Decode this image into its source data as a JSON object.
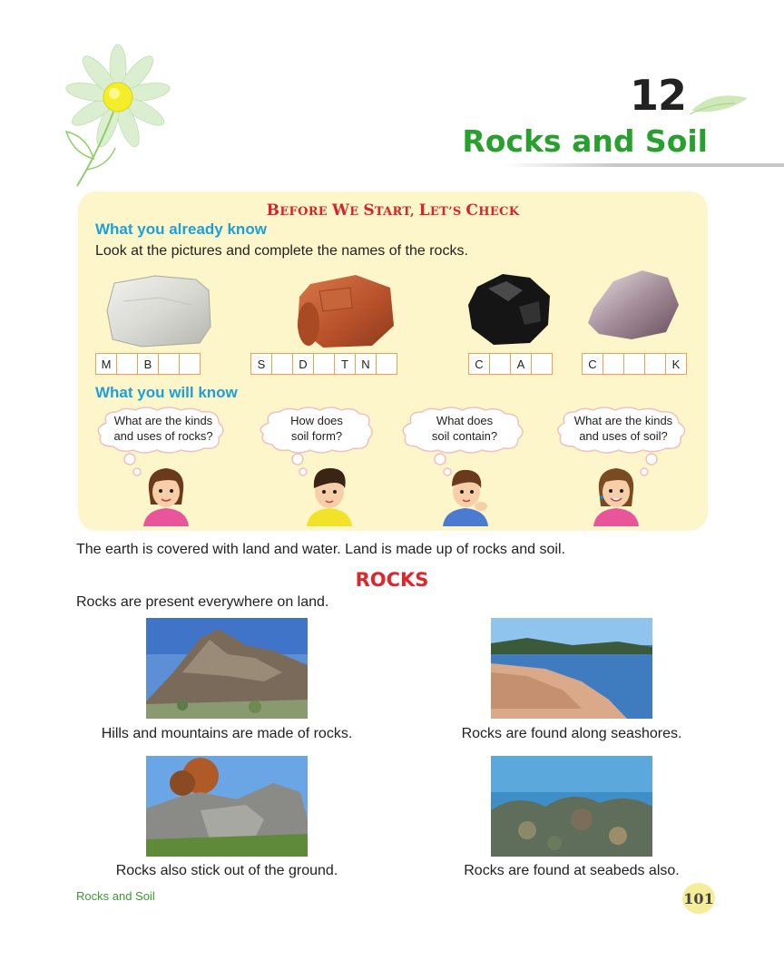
{
  "chapter": {
    "number": "12",
    "title": "Rocks and Soil"
  },
  "check": {
    "heading_part1": "B",
    "heading_part2": "EFORE ",
    "heading_part3": "W",
    "heading_part4": "E ",
    "heading_part5": "S",
    "heading_part6": "TART, ",
    "heading_part7": "L",
    "heading_part8": "ET’S ",
    "heading_part9": "C",
    "heading_part10": "HECK",
    "already_know": "What you already know",
    "instruction": "Look at the pictures and complete the names of the rocks.",
    "words": [
      {
        "cells": [
          "M",
          "",
          "B",
          "",
          ""
        ]
      },
      {
        "cells": [
          "S",
          "",
          "D",
          "",
          "T",
          "N",
          ""
        ]
      },
      {
        "cells": [
          "C",
          "",
          "A",
          ""
        ]
      },
      {
        "cells": [
          "C",
          "",
          "",
          "",
          "K"
        ]
      }
    ],
    "will_know": "What you will know",
    "questions": [
      {
        "line1": "What are the kinds",
        "line2": "and uses of rocks?"
      },
      {
        "line1": "How does",
        "line2": "soil form?"
      },
      {
        "line1": "What does",
        "line2": "soil contain?"
      },
      {
        "line1": "What are the kinds",
        "line2": "and uses of soil?"
      }
    ]
  },
  "intro": "The earth is covered with land and water. Land is made up of rocks and soil.",
  "section": {
    "title": "ROCKS",
    "lead": "Rocks are present everywhere on land.",
    "captions": [
      "Hills and mountains are made of rocks.",
      "Rocks are found along seashores.",
      "Rocks also stick out of the ground.",
      "Rocks are found at seabeds also."
    ]
  },
  "footer": {
    "running_title": "Rocks and Soil",
    "page": "101"
  },
  "colors": {
    "green": "#27a02e",
    "red": "#e0262d",
    "blue": "#1ea0d6",
    "panel": "#fdf6cb"
  }
}
